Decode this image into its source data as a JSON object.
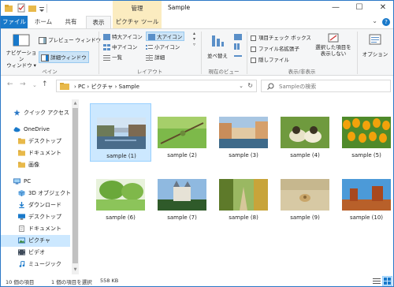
{
  "window": {
    "title": "Sample",
    "context_group": "管理",
    "minimize": "—",
    "maximize": "☐",
    "close": "✕"
  },
  "tabs": {
    "file": "ファイル",
    "home": "ホーム",
    "share": "共有",
    "view": "表示",
    "picture_tools": "ピクチャ ツール"
  },
  "ribbon": {
    "nav_pane": "ナビゲーション\nウィンドウ ▾",
    "preview_pane": "プレビュー ウィンドウ",
    "details_pane": "詳細ウィンドウ",
    "group_pane": "ペイン",
    "xl_icons": "特大アイコン",
    "large_icons": "大アイコン",
    "medium_icons": "中アイコン",
    "small_icons": "小アイコン",
    "list": "一覧",
    "details": "詳細",
    "group_layout": "レイアウト",
    "sort_by": "並べ替え",
    "group_current_view": "現在のビュー",
    "item_checkboxes": "項目チェック ボックス",
    "file_extensions": "ファイル名拡張子",
    "hidden_items": "隠しファイル",
    "hide_selected": "選択した項目を\n表示しない",
    "options": "オプション",
    "group_show_hide": "表示/非表示"
  },
  "address": {
    "crumb_pc": "PC",
    "crumb_pictures": "ピクチャ",
    "crumb_sample": "Sample",
    "separator": "›",
    "search_placeholder": "Sampleの検索"
  },
  "nav_items": [
    {
      "label": "クイック アクセス",
      "icon": "star-icon"
    },
    {
      "label": "OneDrive",
      "icon": "cloud-icon"
    },
    {
      "label": "デスクトップ",
      "icon": "folder-icon"
    },
    {
      "label": "ドキュメント",
      "icon": "folder-icon"
    },
    {
      "label": "画像",
      "icon": "folder-icon"
    },
    {
      "label": "PC",
      "icon": "computer-icon"
    },
    {
      "label": "3D オブジェクト",
      "icon": "cube-icon"
    },
    {
      "label": "ダウンロード",
      "icon": "download-icon"
    },
    {
      "label": "デスクトップ",
      "icon": "desktop-icon"
    },
    {
      "label": "ドキュメント",
      "icon": "document-icon"
    },
    {
      "label": "ピクチャ",
      "icon": "pictures-icon"
    },
    {
      "label": "ビデオ",
      "icon": "video-icon"
    },
    {
      "label": "ミュージック",
      "icon": "music-icon"
    }
  ],
  "files": [
    {
      "name": "sample (1)",
      "selected": true
    },
    {
      "name": "sample (2)",
      "selected": false
    },
    {
      "name": "sample (3)",
      "selected": false
    },
    {
      "name": "sample (4)",
      "selected": false
    },
    {
      "name": "sample (5)",
      "selected": false
    },
    {
      "name": "sample (6)",
      "selected": false
    },
    {
      "name": "sample (7)",
      "selected": false
    },
    {
      "name": "sample (8)",
      "selected": false
    },
    {
      "name": "sample (9)",
      "selected": false
    },
    {
      "name": "sample (10)",
      "selected": false
    }
  ],
  "status": {
    "item_count": "10 個の項目",
    "selection": "1 個の項目を選択",
    "size": "558 KB"
  },
  "colors": {
    "accent": "#1979ca",
    "selection": "#cce8ff",
    "context_tab": "#fbecc0"
  }
}
